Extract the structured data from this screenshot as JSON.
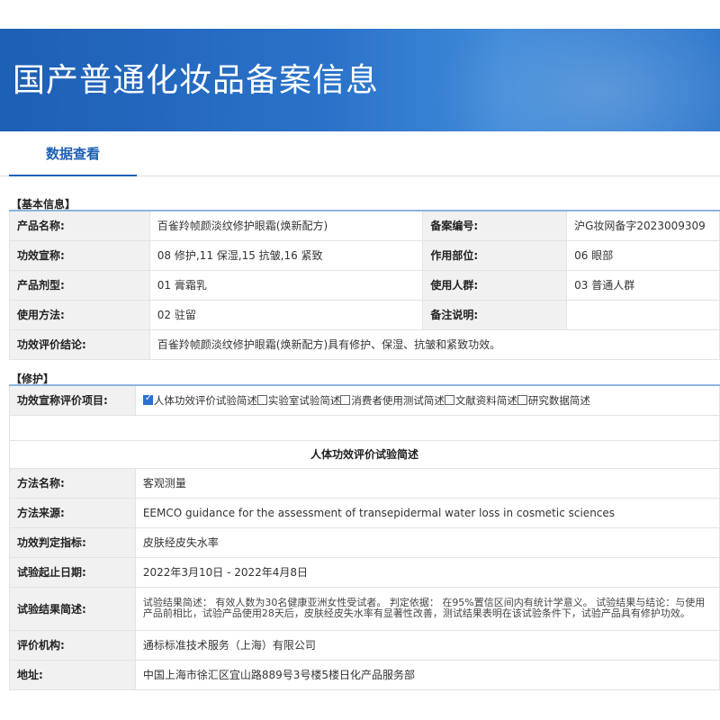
{
  "header": {
    "title": "国产普通化妆品备案信息"
  },
  "tabs": [
    {
      "label": "数据查看"
    }
  ],
  "basic": {
    "section_title": "【基本信息】",
    "product_name_label": "产品名称:",
    "product_name": "百雀羚帧颜淡纹修护眼霜(焕新配方)",
    "record_no_label": "备案编号:",
    "record_no": "沪G妆网备字2023009309",
    "efficacy_label": "功效宣称:",
    "efficacy": "08 修护,11 保湿,15 抗皱,16 紧致",
    "site_label": "作用部位:",
    "site": "06 眼部",
    "form_label": "产品剂型:",
    "form": "01 膏霜乳",
    "crowd_label": "使用人群:",
    "crowd": "03 普通人群",
    "usage_label": "使用方法:",
    "usage": "02 驻留",
    "remark_label": "备注说明:",
    "remark": "",
    "conclusion_label": "功效评价结论:",
    "conclusion": "百雀羚帧颜淡纹修护眼霜(焕新配方)具有修护、保湿、抗皱和紧致功效。"
  },
  "repair": {
    "section_title": "【修护】",
    "items_label": "功效宣称评价项目:",
    "options": [
      {
        "label": "人体功效评价试验简述",
        "checked": true
      },
      {
        "label": "实验室试验简述",
        "checked": false
      },
      {
        "label": "消费者使用测试简述",
        "checked": false
      },
      {
        "label": "文献资料简述",
        "checked": false
      },
      {
        "label": "研究数据简述",
        "checked": false
      }
    ],
    "subheading": "人体功效评价试验简述",
    "method_label": "方法名称:",
    "method": "客观测量",
    "source_label": "方法来源:",
    "source": "EEMCO guidance for the assessment of transepidermal water loss in cosmetic sciences",
    "indicator_label": "功效判定指标:",
    "indicator": "皮肤经皮失水率",
    "dates_label": "试验起止日期:",
    "dates": "2022年3月10日 - 2022年4月8日",
    "summary_label": "试验结果简述:",
    "summary": "试验结果简述： 有效人数为30名健康亚洲女性受试者。 判定依据： 在95%置信区间内有统计学意义。 试验结果与结论：与使用产品前相比，试验产品使用28天后，皮肤经皮失水率有显著性改善，测试结果表明在该试验条件下，试验产品具有修护功效。",
    "org_label": "评价机构:",
    "org": "通标标准技术服务（上海）有限公司",
    "address_label": "地址:",
    "address": "中国上海市徐汇区宜山路889号3号楼5楼日化产品服务部"
  }
}
